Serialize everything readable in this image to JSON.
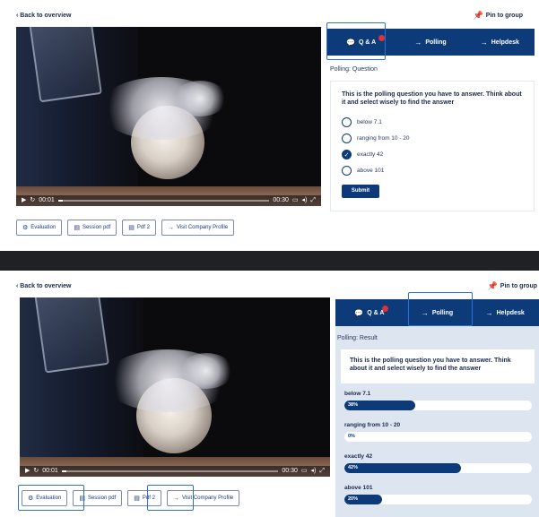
{
  "common": {
    "back_label": "Back to overview",
    "pin_label": "Pin to group",
    "pin_icon": "pin-icon",
    "video": {
      "time_current": "00:01",
      "time_total": "00:30",
      "progress_percent": 2
    },
    "buttons": [
      {
        "icon": "gear-icon",
        "label": "Evaluation"
      },
      {
        "icon": "document-icon",
        "label": "Session pdf"
      },
      {
        "icon": "document-icon",
        "label": "Pdf 2"
      },
      {
        "icon": "arrow-right-icon",
        "label": "Visit Company Profile"
      }
    ],
    "tabs": [
      {
        "icon": "chat-icon",
        "label": "Q & A",
        "has_badge": true
      },
      {
        "icon": "arrow-right-icon",
        "label": "Polling",
        "has_badge": false
      },
      {
        "icon": "arrow-right-icon",
        "label": "Helpdesk",
        "has_badge": false
      }
    ],
    "question": "This is the polling question you have to answer. Think about it and select wisely to find the answer",
    "accent_color": "#0d3a78",
    "highlight_color": "#2e6fd1"
  },
  "panel1": {
    "section_title": "Polling: Question",
    "highlighted_tab": "Q & A",
    "options": [
      {
        "label": "below 7.1",
        "checked": false
      },
      {
        "label": "ranging from 10 - 20",
        "checked": false
      },
      {
        "label": "exactly 42",
        "checked": true
      },
      {
        "label": "above 101",
        "checked": false
      }
    ],
    "submit_label": "Submit"
  },
  "panel2": {
    "section_title": "Polling: Result",
    "highlighted_tab": "Polling",
    "highlighted_buttons": [
      "Evaluation",
      "Pdf 2"
    ],
    "results": [
      {
        "label": "below 7.1",
        "percent_label": "38%",
        "value": 38
      },
      {
        "label": "ranging from 10 - 20",
        "percent_label": "0%",
        "value": 0
      },
      {
        "label": "exactly 42",
        "percent_label": "42%",
        "value": 62
      },
      {
        "label": "above 101",
        "percent_label": "20%",
        "value": 20
      }
    ]
  }
}
